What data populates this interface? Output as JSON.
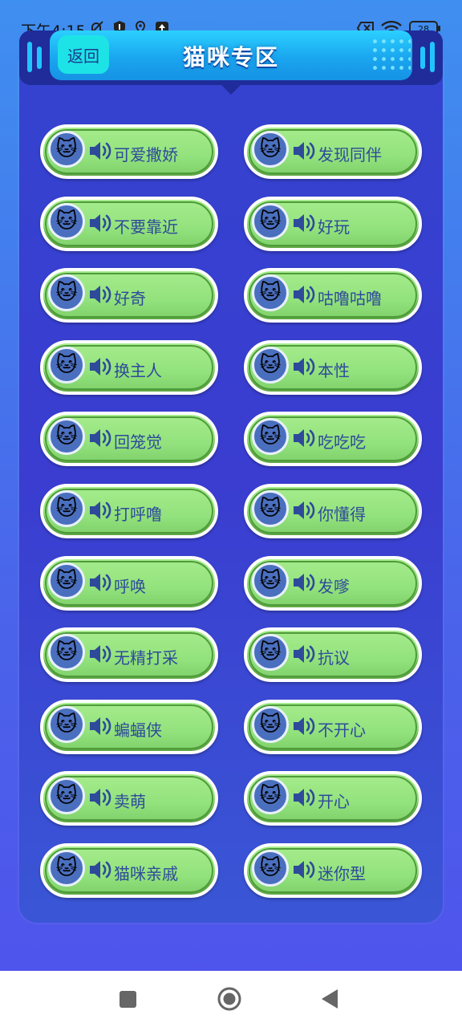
{
  "status_bar": {
    "time": "下午4:15",
    "battery": "28",
    "icons": [
      "mute-icon",
      "shield-icon",
      "location-icon",
      "upload-icon",
      "sim-off-icon",
      "wifi-icon",
      "battery-icon"
    ]
  },
  "header": {
    "back_label": "返回",
    "title": "猫咪专区"
  },
  "colors": {
    "background_top": "#3f8ff0",
    "panel": "#3443cf",
    "header": "#1aa6ef",
    "button_fill": "#92e27d",
    "label_text": "#2e4a9a"
  },
  "sounds": [
    {
      "label": "可爱撒娇",
      "icon": "cat-face-icon"
    },
    {
      "label": "发现同伴",
      "icon": "cat-face-icon"
    },
    {
      "label": "不要靠近",
      "icon": "cat-face-icon"
    },
    {
      "label": "好玩",
      "icon": "cat-face-icon"
    },
    {
      "label": "好奇",
      "icon": "cat-face-icon"
    },
    {
      "label": "咕噜咕噜",
      "icon": "cat-face-icon"
    },
    {
      "label": "换主人",
      "icon": "cat-face-icon"
    },
    {
      "label": "本性",
      "icon": "cat-face-icon"
    },
    {
      "label": "回笼觉",
      "icon": "cat-face-icon"
    },
    {
      "label": "吃吃吃",
      "icon": "cat-face-icon"
    },
    {
      "label": "打呼噜",
      "icon": "cat-face-icon"
    },
    {
      "label": "你懂得",
      "icon": "cat-face-icon"
    },
    {
      "label": "呼唤",
      "icon": "cat-face-icon"
    },
    {
      "label": "发嗲",
      "icon": "cat-face-icon"
    },
    {
      "label": "无精打采",
      "icon": "cat-face-icon"
    },
    {
      "label": "抗议",
      "icon": "cat-face-icon"
    },
    {
      "label": "蝙蝠侠",
      "icon": "cat-face-icon"
    },
    {
      "label": "不开心",
      "icon": "cat-face-icon"
    },
    {
      "label": "卖萌",
      "icon": "cat-face-icon"
    },
    {
      "label": "开心",
      "icon": "cat-face-icon"
    },
    {
      "label": "猫咪亲戚",
      "icon": "cat-face-icon"
    },
    {
      "label": "迷你型",
      "icon": "cat-face-icon"
    }
  ],
  "nav_bar": {
    "icons": [
      "recent-apps-icon",
      "home-icon",
      "back-icon"
    ]
  }
}
